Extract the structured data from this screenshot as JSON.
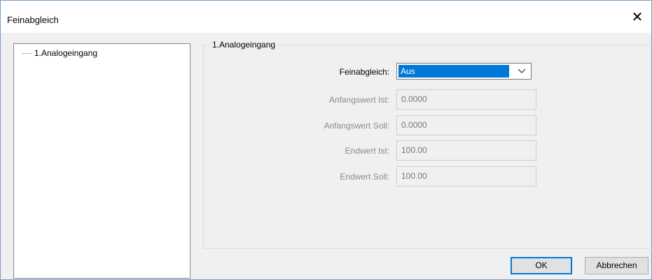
{
  "window": {
    "title": "Feinabgleich",
    "close_glyph": "✕"
  },
  "tree": {
    "items": [
      {
        "label": "1.Analogeingang"
      }
    ]
  },
  "group": {
    "legend": "1.Analogeingang",
    "feinabgleich": {
      "label": "Feinabgleich:",
      "value": "Aus"
    },
    "anfangswert_ist": {
      "label": "Anfangswert Ist:",
      "value": "0.0000"
    },
    "anfangswert_soll": {
      "label": "Anfangswert Soll:",
      "value": "0.0000"
    },
    "endwert_ist": {
      "label": "Endwert Ist:",
      "value": "100.00"
    },
    "endwert_soll": {
      "label": "Endwert Soll:",
      "value": "100.00"
    }
  },
  "buttons": {
    "ok_label": "OK",
    "cancel_label": "Abbrechen"
  },
  "icons": {
    "close": "close-icon",
    "dropdown": "chevron-down-icon"
  },
  "colors": {
    "selection": "#0078d7",
    "disabled_text": "#8b8b8b"
  }
}
